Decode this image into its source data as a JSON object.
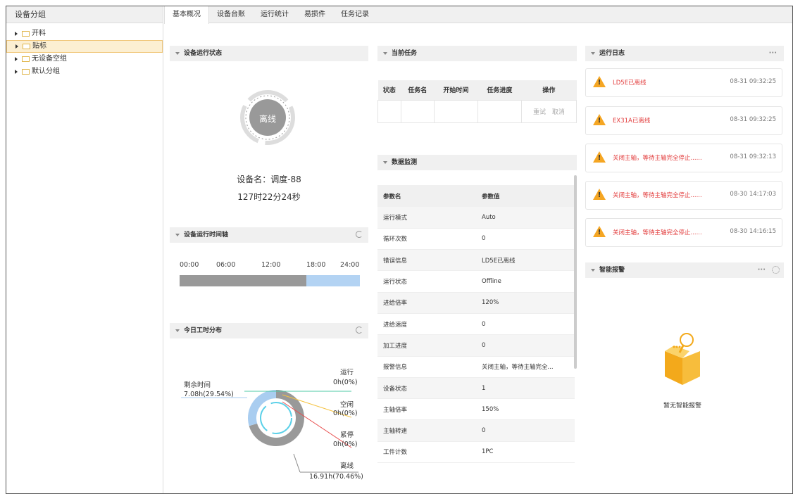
{
  "sidebar": {
    "title": "设备分组",
    "items": [
      {
        "label": "开料"
      },
      {
        "label": "贴标"
      },
      {
        "label": "无设备空组"
      },
      {
        "label": "默认分组"
      }
    ]
  },
  "tabs": [
    "基本概况",
    "设备台账",
    "运行统计",
    "易损件",
    "任务记录"
  ],
  "status_panel": {
    "title": "设备运行状态",
    "state": "离线",
    "device_name": "设备名：调度-88",
    "duration": "127时22分24秒"
  },
  "timeline_panel": {
    "title": "设备运行时间轴",
    "ticks": [
      "00:00",
      "06:00",
      "12:00",
      "18:00",
      "24:00"
    ],
    "offline_fraction": 0.705,
    "colors": {
      "offline": "#999999",
      "remaining": "#b3d3f3"
    }
  },
  "worktime_panel": {
    "title": "今日工时分布",
    "remaining": {
      "label": "剩余时间",
      "value": "7.08h(29.54%)",
      "percent": 29.54,
      "color": "#a9cdf0"
    },
    "legend": [
      {
        "label": "运行",
        "value": "0h(0%)",
        "color": "#4cc9a6"
      },
      {
        "label": "空闲",
        "value": "0h(0%)",
        "color": "#f5c342"
      },
      {
        "label": "紧停",
        "value": "0h(0%)",
        "color": "#e84d4d"
      },
      {
        "label": "离线",
        "value": "16.91h(70.46%)",
        "color": "#999999",
        "percent": 70.46
      }
    ]
  },
  "task_panel": {
    "title": "当前任务",
    "columns": [
      "状态",
      "任务名",
      "开始时间",
      "任务进度",
      "操作"
    ],
    "actions": [
      "重试",
      "取消"
    ]
  },
  "data_panel": {
    "title": "数据监测",
    "columns": [
      "参数名",
      "参数值"
    ],
    "rows": [
      [
        "运行模式",
        "Auto"
      ],
      [
        "循环次数",
        "0"
      ],
      [
        "错误信息",
        "LD5E已离线"
      ],
      [
        "运行状态",
        "Offline"
      ],
      [
        "进给倍率",
        "120%"
      ],
      [
        "进给速度",
        "0"
      ],
      [
        "加工进度",
        "0"
      ],
      [
        "报警信息",
        "关闭主轴，等待主轴完全..."
      ],
      [
        "设备状态",
        "1"
      ],
      [
        "主轴倍率",
        "150%"
      ],
      [
        "主轴转速",
        "0"
      ],
      [
        "工件计数",
        "1PC"
      ]
    ]
  },
  "log_panel": {
    "title": "运行日志",
    "more": "···",
    "items": [
      {
        "text": "LD5E已离线",
        "time": "08-31 09:32:25"
      },
      {
        "text": "EX31A已离线",
        "time": "08-31 09:32:25"
      },
      {
        "text": "关闭主轴，等待主轴完全停止......",
        "time": "08-31 09:32:13"
      },
      {
        "text": "关闭主轴，等待主轴完全停止......",
        "time": "08-30 14:17:03"
      },
      {
        "text": "关闭主轴，等待主轴完全停止......",
        "time": "08-30 14:16:15"
      }
    ]
  },
  "alarm_panel": {
    "title": "智能报警",
    "more": "···",
    "empty_text": "暂无智能报警"
  }
}
